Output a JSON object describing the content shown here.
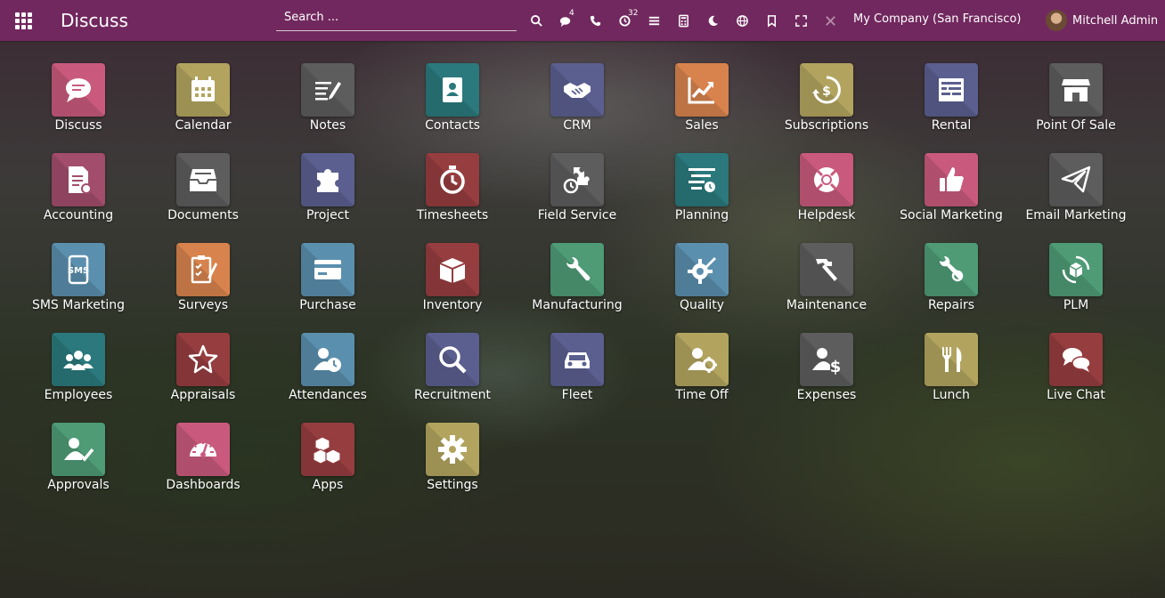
{
  "navbar": {
    "title": "Discuss",
    "search_placeholder": "Search ...",
    "messages_count": "4",
    "activities_count": "32",
    "company": "My Company (San Francisco)",
    "user": "Mitchell Admin",
    "color": "#71285e"
  },
  "apps": [
    {
      "label": "Discuss",
      "icon": "chat-bubble-icon",
      "color": "#c95a7d"
    },
    {
      "label": "Calendar",
      "icon": "calendar-icon",
      "color": "#b2a45f"
    },
    {
      "label": "Notes",
      "icon": "notes-icon",
      "color": "#5d5d5d"
    },
    {
      "label": "Contacts",
      "icon": "address-book-icon",
      "color": "#2b797c"
    },
    {
      "label": "CRM",
      "icon": "handshake-icon",
      "color": "#5b5f8f"
    },
    {
      "label": "Sales",
      "icon": "chart-up-icon",
      "color": "#d8834d"
    },
    {
      "label": "Subscriptions",
      "icon": "dollar-cycle-icon",
      "color": "#b2a45f"
    },
    {
      "label": "Rental",
      "icon": "rental-sheet-icon",
      "color": "#5b5f8f"
    },
    {
      "label": "Point Of Sale",
      "icon": "store-icon",
      "color": "#5d5d5d"
    },
    {
      "label": "Accounting",
      "icon": "invoice-icon",
      "color": "#a24d6b"
    },
    {
      "label": "Documents",
      "icon": "inbox-icon",
      "color": "#5d5d5d"
    },
    {
      "label": "Project",
      "icon": "puzzle-icon",
      "color": "#5b5f8f"
    },
    {
      "label": "Timesheets",
      "icon": "stopwatch-icon",
      "color": "#963d3f"
    },
    {
      "label": "Field Service",
      "icon": "field-service-icon",
      "color": "#5d5d5d"
    },
    {
      "label": "Planning",
      "icon": "planning-icon",
      "color": "#2b797c"
    },
    {
      "label": "Helpdesk",
      "icon": "lifebuoy-icon",
      "color": "#c95a7d"
    },
    {
      "label": "Social Marketing",
      "icon": "thumbs-up-icon",
      "color": "#c95a7d"
    },
    {
      "label": "Email Marketing",
      "icon": "paper-plane-icon",
      "color": "#5d5d5d"
    },
    {
      "label": "SMS Marketing",
      "icon": "sms-phone-icon",
      "color": "#5b8fae"
    },
    {
      "label": "Surveys",
      "icon": "checklist-icon",
      "color": "#d8834d"
    },
    {
      "label": "Purchase",
      "icon": "credit-card-icon",
      "color": "#5b8fae"
    },
    {
      "label": "Inventory",
      "icon": "box-icon",
      "color": "#963d3f"
    },
    {
      "label": "Manufacturing",
      "icon": "wrench-icon",
      "color": "#4e9b76"
    },
    {
      "label": "Quality",
      "icon": "quality-gear-icon",
      "color": "#5b8fae"
    },
    {
      "label": "Maintenance",
      "icon": "hammer-icon",
      "color": "#5d5d5d"
    },
    {
      "label": "Repairs",
      "icon": "repair-tools-icon",
      "color": "#4e9b76"
    },
    {
      "label": "PLM",
      "icon": "plm-cycle-icon",
      "color": "#4e9b76"
    },
    {
      "label": "Employees",
      "icon": "users-icon",
      "color": "#2b797c"
    },
    {
      "label": "Appraisals",
      "icon": "star-icon",
      "color": "#963d3f"
    },
    {
      "label": "Attendances",
      "icon": "user-clock-icon",
      "color": "#5b8fae"
    },
    {
      "label": "Recruitment",
      "icon": "magnifier-icon",
      "color": "#5b5f8f"
    },
    {
      "label": "Fleet",
      "icon": "car-icon",
      "color": "#5b5f8f"
    },
    {
      "label": "Time Off",
      "icon": "user-gear-icon",
      "color": "#b2a45f"
    },
    {
      "label": "Expenses",
      "icon": "user-dollar-icon",
      "color": "#5d5d5d"
    },
    {
      "label": "Lunch",
      "icon": "cutlery-icon",
      "color": "#b2a45f"
    },
    {
      "label": "Live Chat",
      "icon": "chat-bubbles-icon",
      "color": "#963d3f"
    },
    {
      "label": "Approvals",
      "icon": "user-check-icon",
      "color": "#4e9b76"
    },
    {
      "label": "Dashboards",
      "icon": "gauge-icon",
      "color": "#c95a7d"
    },
    {
      "label": "Apps",
      "icon": "cubes-icon",
      "color": "#963d3f"
    },
    {
      "label": "Settings",
      "icon": "gear-icon",
      "color": "#b2a45f"
    }
  ]
}
